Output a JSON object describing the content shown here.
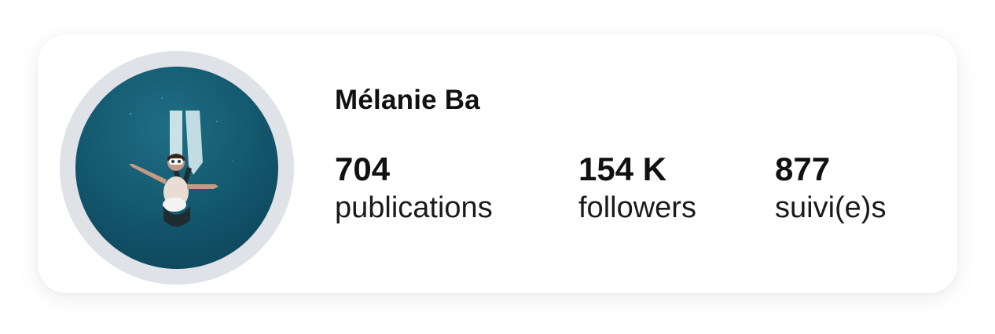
{
  "profile": {
    "name": "Mélanie Ba"
  },
  "stats": [
    {
      "value": "704",
      "label": "publications"
    },
    {
      "value": "154 K",
      "label": "followers"
    },
    {
      "value": "877",
      "label": "suivi(e)s"
    }
  ],
  "colors": {
    "card_background": "#ffffff",
    "avatar_ring": "#dfe2e7",
    "text": "#111111",
    "avatar_water": "#145a70"
  },
  "avatar": {
    "icon": "profile-photo-freediver"
  }
}
